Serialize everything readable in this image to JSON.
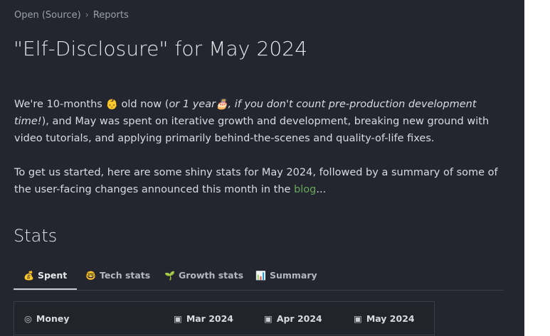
{
  "breadcrumb": {
    "items": [
      "Open (Source)",
      "Reports"
    ],
    "separator": "›"
  },
  "page": {
    "title": "\"Elf-Disclosure\" for May 2024"
  },
  "intro": {
    "p1_part1": "We're 10-months ",
    "p1_emoji_baby": "👶",
    "p1_part2": " old now (",
    "p1_em1": "or 1 year",
    "p1_emoji_cake": "🎂",
    "p1_em2": ", if you don't count pre-production development time!",
    "p1_part3": "), and May was spent on iterative growth and development, breaking new ground with video tutorials, and applying primarily behind-the-scenes and quality-of-life fixes.",
    "p2_part1": "To get us started, here are some shiny stats for May 2024, followed by a summary of some of the user-facing changes announced this month in the ",
    "p2_link": "blog",
    "p2_part2": "..."
  },
  "stats": {
    "heading": "Stats",
    "tabs": [
      {
        "icon": "💰",
        "label": "Spent",
        "active": true
      },
      {
        "icon": "🤓",
        "label": "Tech stats",
        "active": false
      },
      {
        "icon": "🌱",
        "label": "Growth stats",
        "active": false
      },
      {
        "icon": "📊",
        "label": "Summary",
        "active": false
      }
    ],
    "table": {
      "headers": [
        {
          "icon": "◎",
          "label": "Money"
        },
        {
          "icon": "▣",
          "label": "Mar 2024"
        },
        {
          "icon": "▣",
          "label": "Apr 2024"
        },
        {
          "icon": "▣",
          "label": "May 2024"
        }
      ]
    }
  },
  "colors": {
    "background": "#24262f",
    "text": "#d9dbe1",
    "link": "#67a85a",
    "border": "#3a3d47"
  }
}
